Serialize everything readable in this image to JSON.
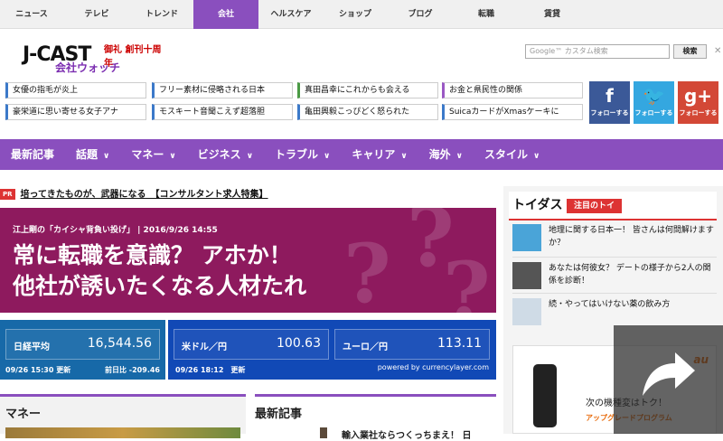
{
  "topnav": {
    "items": [
      {
        "label": "ニュース",
        "active": false
      },
      {
        "label": "テレビ",
        "active": false
      },
      {
        "label": "トレンド",
        "active": false
      },
      {
        "label": "会社",
        "active": true
      },
      {
        "label": "ヘルスケア",
        "active": false
      },
      {
        "label": "ショップ",
        "active": false
      },
      {
        "label": "ブログ",
        "active": false
      },
      {
        "label": "転職",
        "active": false
      },
      {
        "label": "賃貸",
        "active": false
      }
    ]
  },
  "logo": {
    "main": "J-CAST",
    "sub": "会社ウォッチ",
    "anniv": "御礼 創刊十周年"
  },
  "search": {
    "placeholder": "Google™ カスタム検索",
    "button": "検索",
    "close": "✕"
  },
  "links": {
    "col1": [
      "女優の指毛が炎上",
      "豪栄道に思い寄せる女子アナ"
    ],
    "col2": [
      "フリー素材に侵略される日本",
      "モスキート音聞こえず超落胆"
    ],
    "col3": [
      "真田昌幸にこれからも会える",
      "亀田興毅こっぴどく怒られた"
    ],
    "col4": [
      "お金と県民性の関係",
      "SuicaカードがXmasケーキに"
    ]
  },
  "social": {
    "facebook": {
      "glyph": "f",
      "label": "フォローする",
      "color": "#3b5998"
    },
    "twitter": {
      "glyph": "🐦",
      "label": "フォローする",
      "color": "#34a7e0"
    },
    "gplus": {
      "glyph": "g+",
      "label": "フォローする",
      "color": "#d34836"
    }
  },
  "catnav": [
    "最新記事",
    "話題",
    "マネー",
    "ビジネス",
    "トラブル",
    "キャリア",
    "海外",
    "スタイル"
  ],
  "pr": {
    "badge": "PR",
    "text": "培ってきたものが、武器になる　【コンサルタント求人特集】"
  },
  "hero": {
    "meta": "江上剛の「カイシャ背負い投げ」 | 2016/9/26 14:55",
    "line1": "常に転職を意識？ アホか！",
    "line2": "他社が誘いたくなる人材たれ"
  },
  "market": {
    "nikkei": {
      "label": "日経平均",
      "value": "16,544.56",
      "date": "09/26 15:30 更新",
      "change": "前日比 -209.46"
    },
    "usd": {
      "label": "米ドル／円",
      "value": "100.63"
    },
    "eur": {
      "label": "ユーロ／円",
      "value": "113.11"
    },
    "fx_date": "09/26 18:12　更新",
    "powered": "powered by currencylayer.com"
  },
  "sections": {
    "money": "マネー",
    "latest": "最新記事",
    "latest_item": "輸入業社ならつくっちまえ！ 日"
  },
  "sidebar": {
    "logo": "トイダス",
    "tag": "注目のトイ",
    "items": [
      {
        "text": "地理に関する日本一！ 皆さんは何問解けますか？"
      },
      {
        "text": "あなたは何彼女？ デートの様子から2人の関係を診断！"
      },
      {
        "text": "続・やってはいけない薬の飲み方"
      }
    ]
  },
  "ad": {
    "brand": "au",
    "text1": "次の機種変はトク！",
    "text2": "アップグレードプログラム"
  }
}
